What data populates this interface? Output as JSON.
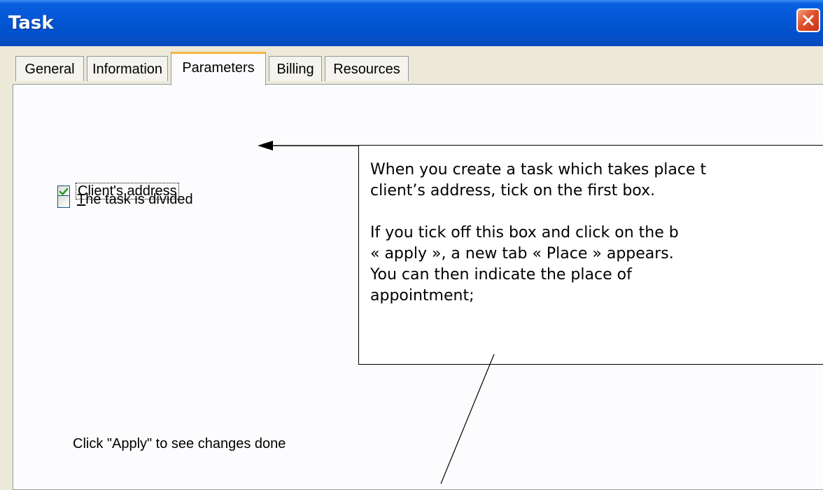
{
  "window": {
    "title": "Task"
  },
  "tabs": [
    {
      "label": "General"
    },
    {
      "label": "Information"
    },
    {
      "label": "Parameters",
      "active": true
    },
    {
      "label": "Billing"
    },
    {
      "label": "Resources"
    }
  ],
  "options": [
    {
      "label_rest": "Client's address",
      "checked": true
    },
    {
      "mnemonic": "T",
      "label_rest": "he task is divided",
      "checked": false
    }
  ],
  "hint": "Click \"Apply\" to see changes done",
  "callout": {
    "lines": [
      "When you create a task which takes place t",
      "client’s address, tick on the first box.",
      "",
      "If you tick off this box and click on the b",
      "« apply », a new tab « Place » appears.",
      "You  can  then  indicate  the  place  of",
      "appointment;"
    ]
  },
  "icons": [
    "close-icon",
    "check-icon",
    "arrow-left-icon"
  ]
}
